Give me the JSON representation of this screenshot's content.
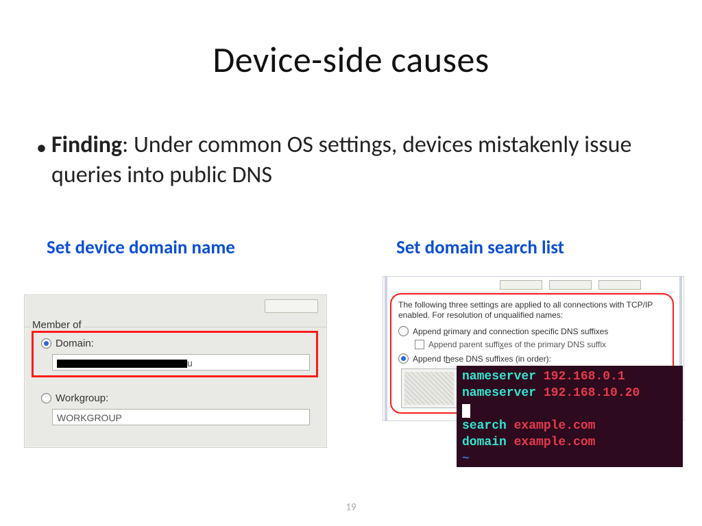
{
  "title": "Device-side causes",
  "bullet": {
    "label": "Finding",
    "text": ": Under common OS settings, devices mistakenly issue queries into public DNS"
  },
  "subheads": {
    "left": "Set device domain name",
    "right": "Set domain search list"
  },
  "win": {
    "group_label": "Member of",
    "domain_label": "Domain:",
    "domain_suffix": "u",
    "workgroup_label": "Workgroup:",
    "workgroup_value": "WORKGROUP"
  },
  "dns": {
    "intro": "The following three settings are applied to all connections with TCP/IP enabled. For resolution of unqualified names:",
    "opt1_pre": "Append ",
    "opt1_u": "p",
    "opt1_post": "rimary and connection specific DNS suffixes",
    "opt1a_pre": "Append parent suffi",
    "opt1a_u": "x",
    "opt1a_post": "es of the primary DNS suffix",
    "opt2_pre": "Append t",
    "opt2_u": "h",
    "opt2_post": "ese DNS suffixes (in order):"
  },
  "terminal": {
    "l1_k": "nameserver",
    "l1_v": "192.168.0.1",
    "l2_k": "nameserver",
    "l2_v": "192.168.10.20",
    "l4_k": "search",
    "l4_v": "example.com",
    "l5_k": "domain",
    "l5_v": "example.com",
    "tilde": "~"
  },
  "pagenum": "19"
}
